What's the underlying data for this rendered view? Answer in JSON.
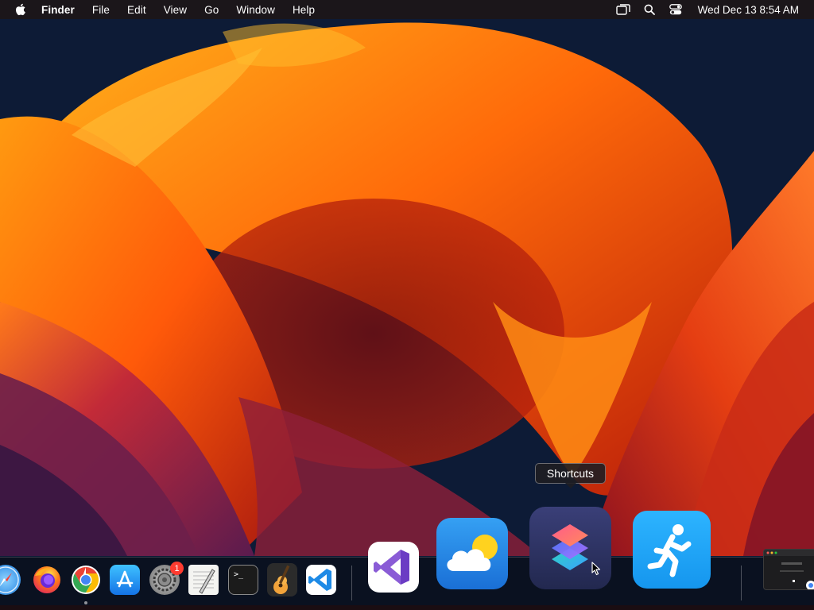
{
  "menubar": {
    "app_name": "Finder",
    "items": [
      "File",
      "Edit",
      "View",
      "Go",
      "Window",
      "Help"
    ],
    "clock": "Wed Dec 13  8:54 AM",
    "status_icons": [
      "screen-mirroring-icon",
      "spotlight-search-icon",
      "control-center-icon"
    ]
  },
  "dock": {
    "tooltip": "Shortcuts",
    "badge_count": "1",
    "apps": [
      {
        "name": "Safari",
        "icon": "safari-icon"
      },
      {
        "name": "Firefox",
        "icon": "firefox-icon"
      },
      {
        "name": "Google Chrome",
        "icon": "chrome-icon"
      },
      {
        "name": "App Store",
        "icon": "app-store-icon"
      },
      {
        "name": "System Settings",
        "icon": "system-settings-icon"
      },
      {
        "name": "TextEdit",
        "icon": "textedit-icon"
      },
      {
        "name": "Terminal",
        "icon": "terminal-icon"
      },
      {
        "name": "GarageBand",
        "icon": "garageband-icon"
      },
      {
        "name": "Visual Studio Code",
        "icon": "vscode-icon"
      },
      {
        "name": "Visual Studio",
        "icon": "visual-studio-icon"
      },
      {
        "name": "Weather",
        "icon": "weather-icon"
      },
      {
        "name": "Shortcuts",
        "icon": "shortcuts-icon"
      },
      {
        "name": "Fitness",
        "icon": "fitness-icon"
      },
      {
        "name": "Minimized Window",
        "icon": "minimized-window-thumbnail"
      }
    ],
    "terminal_prompt": ">_",
    "running_indicator_app": "Google Chrome"
  },
  "colors": {
    "accent_orange": "#ff8a00",
    "badge_red": "#ff3b30",
    "fitness_blue": "#19a6f5",
    "weather_blue": "#1f7be0",
    "vscode_blue": "#1e8ae6"
  }
}
